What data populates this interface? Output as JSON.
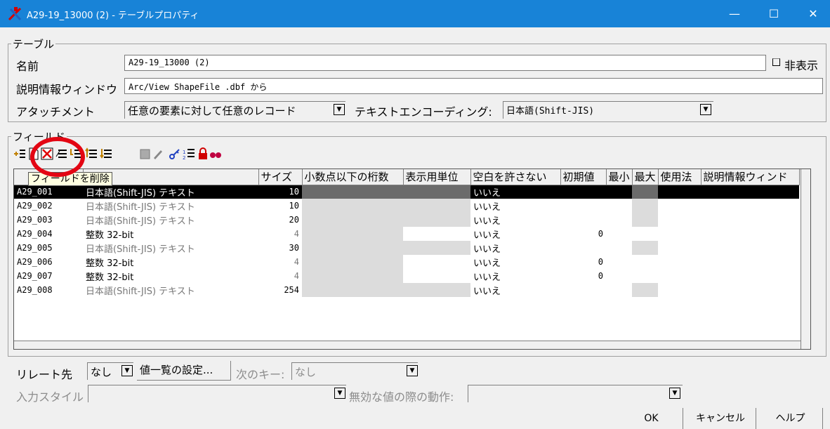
{
  "window": {
    "title": "A29-19_13000 (2) - テーブルプロパティ",
    "minimize": "—",
    "maximize": "☐",
    "close": "✕"
  },
  "table_group": {
    "title": "テーブル",
    "name_label": "名前",
    "name_value": "A29-19_13000 (2)",
    "hidden_label": "非表示",
    "description_label": "説明情報ウィンドウ",
    "description_value": "Arc/View ShapeFile .dbf から",
    "attachment_label": "アタッチメント",
    "attachment_value": "任意の要素に対して任意のレコード",
    "encoding_label": "テキストエンコーディング:",
    "encoding_value": "日本語(Shift-JIS)"
  },
  "fields_group": {
    "title": "フィールド",
    "tooltip": "フィールドを削除",
    "columns": [
      "",
      "",
      "サイズ",
      "小数点以下の桁数",
      "表示用単位",
      "空白を許さない",
      "初期値",
      "最小",
      "最大",
      "使用法",
      "説明情報ウィンド"
    ],
    "rows": [
      {
        "name": "A29_001",
        "type": "日本語(Shift-JIS) テキスト",
        "size": "10",
        "notnull": "いいえ",
        "default": ""
      },
      {
        "name": "A29_002",
        "type": "日本語(Shift-JIS) テキスト",
        "size": "10",
        "notnull": "いいえ",
        "default": ""
      },
      {
        "name": "A29_003",
        "type": "日本語(Shift-JIS) テキスト",
        "size": "20",
        "notnull": "いいえ",
        "default": ""
      },
      {
        "name": "A29_004",
        "type": "整数 32-bit",
        "size": "4",
        "notnull": "いいえ",
        "default": "0"
      },
      {
        "name": "A29_005",
        "type": "日本語(Shift-JIS) テキスト",
        "size": "30",
        "notnull": "いいえ",
        "default": ""
      },
      {
        "name": "A29_006",
        "type": "整数 32-bit",
        "size": "4",
        "notnull": "いいえ",
        "default": "0"
      },
      {
        "name": "A29_007",
        "type": "整数 32-bit",
        "size": "4",
        "notnull": "いいえ",
        "default": "0"
      },
      {
        "name": "A29_008",
        "type": "日本語(Shift-JIS) テキスト",
        "size": "254",
        "notnull": "いいえ",
        "default": ""
      }
    ]
  },
  "relate": {
    "label": "リレート先",
    "value": "なし",
    "valuelist_button": "値一覧の設定...",
    "nextkey_label": "次のキー:",
    "nextkey_value": "なし",
    "inputstyle_label": "入力スタイル",
    "invalid_label": "無効な値の際の動作:"
  },
  "buttons": {
    "ok": "OK",
    "cancel": "キャンセル",
    "help": "ヘルプ"
  }
}
